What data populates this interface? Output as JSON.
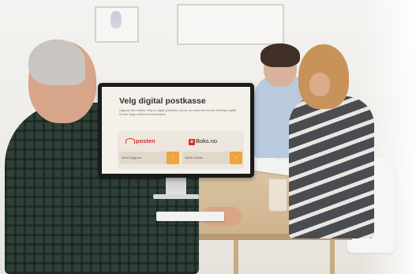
{
  "screen": {
    "title": "Velg digital postkasse",
    "description": "Digipost eller e-Boks: Velg en digital postkasse, så kan du motta brev fra det offentlige digitalt. Du kan velge mellom to leverandører.",
    "providers": [
      {
        "logo_text": "posten",
        "logo_icon": "posten-horn-icon",
        "button_label": "Gå til Digipost",
        "button_icon": "arrow-right-icon"
      },
      {
        "logo_text": "Boks.no",
        "logo_icon": "eboks-e-icon",
        "logo_prefix": "e",
        "button_label": "Gå til e-Boks",
        "button_icon": "arrow-right-icon"
      }
    ]
  },
  "colors": {
    "accent_orange": "#f0a43c",
    "posten_red": "#d0332c",
    "panel": "#ece6dd"
  }
}
